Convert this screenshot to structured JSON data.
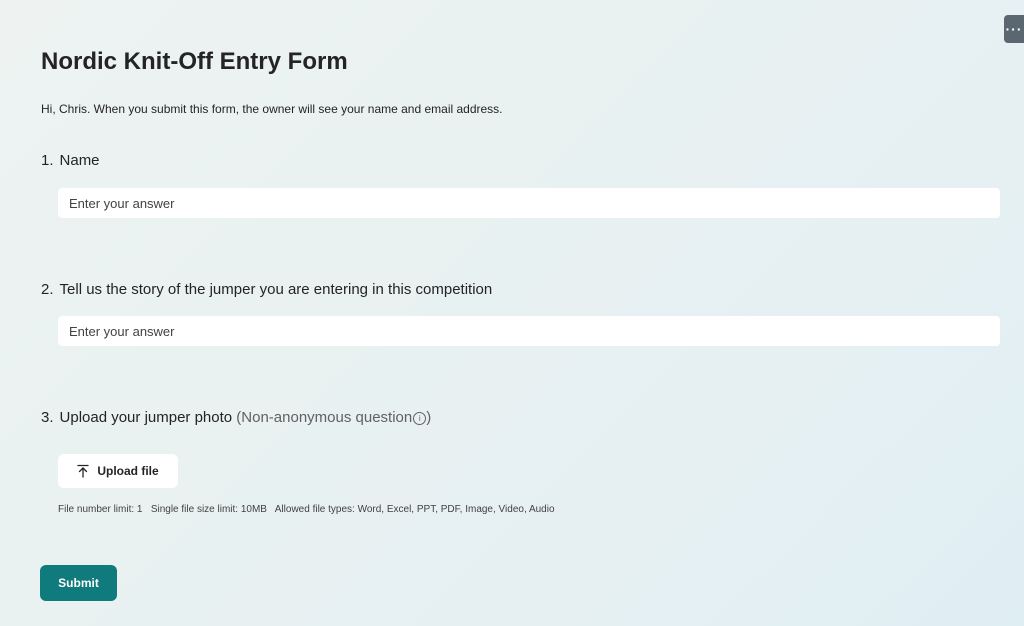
{
  "form": {
    "title": "Nordic Knit-Off Entry Form",
    "intro": "Hi, Chris. When you submit this form, the owner will see your name and email address.",
    "more_icon": "more-horizontal-icon"
  },
  "questions": [
    {
      "number": "1.",
      "label": "Name",
      "placeholder": "Enter your answer",
      "value": ""
    },
    {
      "number": "2.",
      "label": "Tell us the story of the jumper you are entering in this competition",
      "placeholder": "Enter your answer",
      "value": ""
    },
    {
      "number": "3.",
      "label": "Upload your jumper photo",
      "note_open": " (Non-anonymous question",
      "note_close": ")",
      "info_icon": "info-icon",
      "upload_label": "Upload file",
      "upload_icon": "upload-arrow-icon",
      "limits": {
        "file_number": "File number limit: 1",
        "file_size": "Single file size limit: 10MB",
        "file_types": "Allowed file types: Word, Excel, PPT, PDF, Image, Video, Audio"
      }
    }
  ],
  "submit_label": "Submit",
  "colors": {
    "accent": "#0f7b7c",
    "more_button": "#5b6770"
  }
}
